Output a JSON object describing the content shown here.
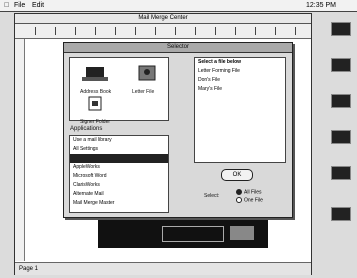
{
  "menubar": {
    "apple": "",
    "menus": [
      "File",
      "Edit"
    ],
    "clock": "12:35 PM"
  },
  "document": {
    "title": "Mail Merge Center",
    "status": "Page 1"
  },
  "dialog": {
    "title": "Selector",
    "icons": [
      "Address Book",
      "Letter File",
      "Signer Folder"
    ],
    "list_header": "Applications",
    "list_items": [
      "Use a mail library",
      "All Settings",
      "",
      "AppleWorks",
      "Microsoft Word",
      "ClarisWorks",
      "Alternate Mail",
      "Mail Merge Master"
    ],
    "selected_index": 2,
    "right_header": "Select a file below",
    "right_items": [
      "Letter Forming File",
      "Don's File",
      "Mary's File"
    ],
    "ok_label": "OK",
    "radio_label": "Select:",
    "radio_options": [
      "All Files",
      "One File"
    ],
    "radio_selected": 0
  },
  "sidebar": {
    "icons": [
      "hard-disk-icon",
      "folder-icon",
      "document-icon",
      "application-icon",
      "folder-icon",
      "trash-icon"
    ]
  }
}
